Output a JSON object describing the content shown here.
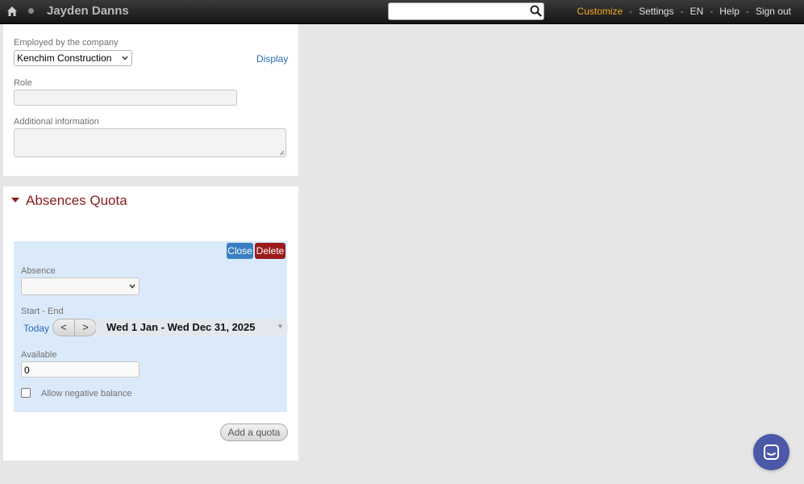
{
  "topbar": {
    "user_name": "Jayden Danns",
    "search": {
      "value": "",
      "placeholder": ""
    },
    "links": {
      "customize": "Customize",
      "settings": "Settings",
      "language": "EN",
      "help": "Help",
      "sign_out": "Sign out"
    },
    "separator": "-"
  },
  "employment": {
    "company_label": "Employed by the company",
    "company_value": "Kenchim Construction",
    "display_link": "Display",
    "role_label": "Role",
    "role_value": "",
    "additional_label": "Additional information",
    "additional_value": ""
  },
  "absences": {
    "title": "Absences Quota",
    "close_label": "Close",
    "delete_label": "Delete",
    "absence_label": "Absence",
    "absence_value": "",
    "start_end_label": "Start - End",
    "today_label": "Today",
    "prev_label": "<",
    "next_label": ">",
    "date_range": "Wed 1 Jan - Wed Dec 31, 2025",
    "available_label": "Available",
    "available_value": "0",
    "allow_negative_label": "Allow negative balance",
    "allow_negative_checked": false,
    "add_quota_label": "Add a quota"
  },
  "colors": {
    "accent": "#f5a623",
    "section_title": "#8b1b1b",
    "close_button": "#3a7ec2",
    "delete_button": "#9b1b1b",
    "quota_bg": "#dbeafa",
    "chat": "#4b59a8"
  },
  "icons": {
    "home": "home-icon",
    "search": "search-icon",
    "chat": "chat-icon",
    "caret": "caret-down-icon"
  }
}
